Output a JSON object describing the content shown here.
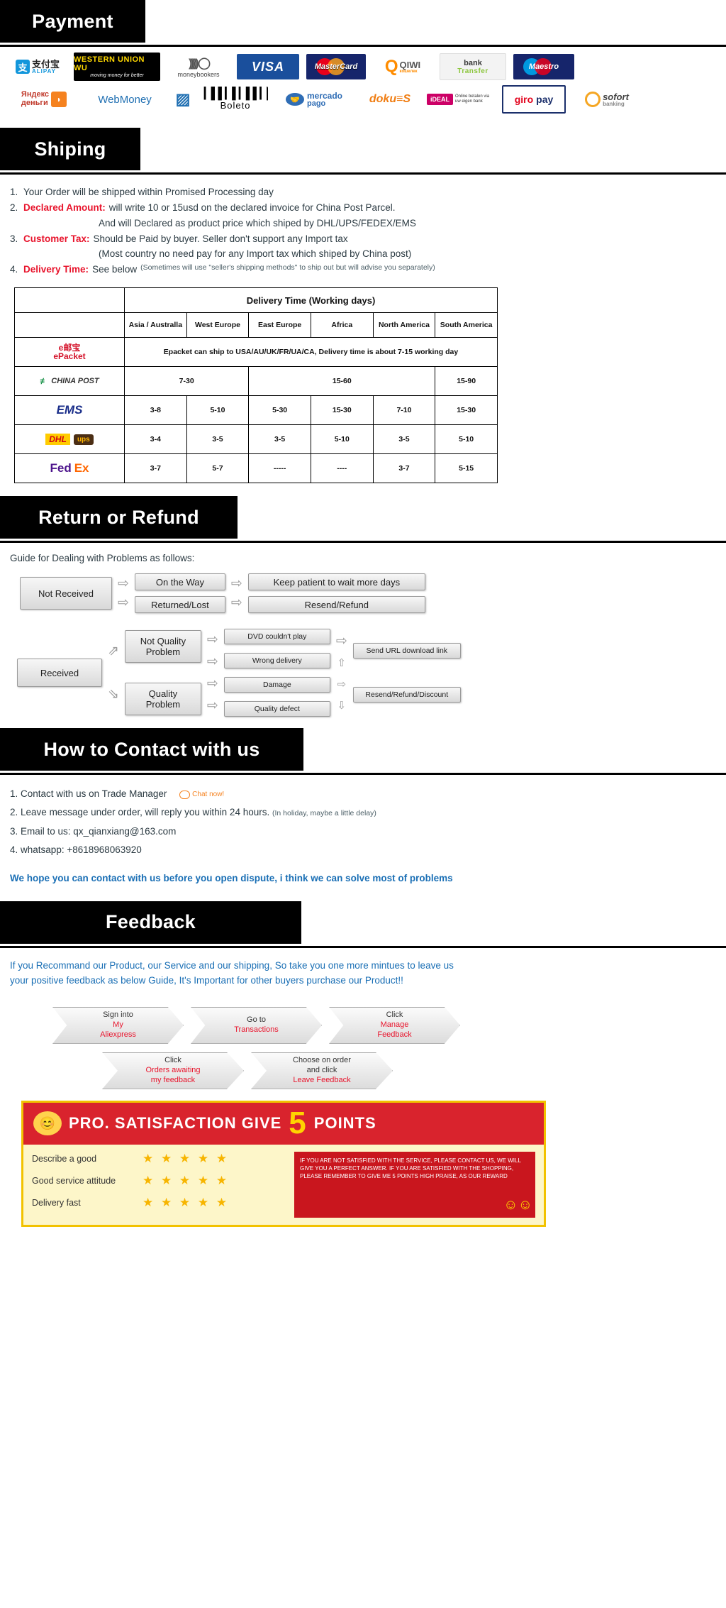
{
  "sections": {
    "payment": "Payment",
    "shipping": "Shiping",
    "return": "Return or Refund",
    "contact": "How to Contact with us",
    "feedback": "Feedback"
  },
  "payment": {
    "row1": [
      {
        "name": "alipay",
        "zh": "支",
        "cn": "支付宝",
        "en": "ALIPAY"
      },
      {
        "name": "western-union",
        "t1": "WESTERN UNION WU",
        "t2": "moving money for better"
      },
      {
        "name": "moneybookers",
        "arcs": "))))) ◯",
        "t": "moneybookers"
      },
      {
        "name": "visa",
        "t": "VISA"
      },
      {
        "name": "mastercard",
        "t": "MasterCard"
      },
      {
        "name": "qiwi",
        "q": "Q",
        "t": "QIWI",
        "sub": "кошелек"
      },
      {
        "name": "bank-transfer",
        "t1": "bank",
        "t2": "Transfer"
      },
      {
        "name": "maestro",
        "t": "Maestro"
      }
    ],
    "row2": [
      {
        "name": "yandex-money",
        "t1": "Яндекс",
        "t2": "деньги",
        "icon": "◗"
      },
      {
        "name": "webmoney",
        "t": "WebMoney"
      },
      {
        "name": "webmoney-icon",
        "t": "▨"
      },
      {
        "name": "boleto",
        "bars": "▌▎▌▌▎▌▎▌▌▎▌",
        "t": "Boleto"
      },
      {
        "name": "mercado-pago",
        "icon": "🤝",
        "t1": "mercado",
        "t2": "pago"
      },
      {
        "name": "doku",
        "t": "doku≡S"
      },
      {
        "name": "ideal",
        "box": "iDEAL",
        "t": "Online betalen via uw eigen bank"
      },
      {
        "name": "giropay",
        "g": "giro",
        "p": "pay"
      },
      {
        "name": "sofort",
        "t": "sofort",
        "sub": "banking"
      }
    ]
  },
  "shipping": {
    "items": [
      {
        "num": "1.",
        "label": "",
        "text": "Your Order will be shipped within Promised Processing day"
      },
      {
        "num": "2.",
        "label": "Declared Amount:",
        "text": "will write 10 or 15usd on the declared invoice for China Post Parcel."
      },
      {
        "num": "",
        "label": "",
        "indent": true,
        "text": "And will Declared as product price which shiped by DHL/UPS/FEDEX/EMS"
      },
      {
        "num": "3.",
        "label": "Customer Tax:",
        "text": "Should be Paid by buyer. Seller don't support any Import tax"
      },
      {
        "num": "",
        "label": "",
        "indent": true,
        "text": "(Most country no need pay for any Import tax which shiped by China post)"
      },
      {
        "num": "4.",
        "label": "Delivery Time:",
        "text": "See below",
        "note": "(Sometimes will use \"seller's shipping methods\" to ship out but will advise you separately)"
      }
    ]
  },
  "delivery_table": {
    "title": "Delivery Time (Working days)",
    "regions": [
      "Asia / Australla",
      "West Europe",
      "East Europe",
      "Africa",
      "North America",
      "South America"
    ],
    "rows": [
      {
        "carrier": "ePacket",
        "type": "epacket",
        "span_note": "Epacket can ship to USA/AU/UK/FR/UA/CA, Delivery time is about 7-15 working day"
      },
      {
        "carrier": "CHINA POST",
        "type": "chinapost",
        "groups": [
          {
            "text": "7-30",
            "span": 2
          },
          {
            "text": "15-60",
            "span": 3
          },
          {
            "text": "15-90",
            "span": 1
          }
        ]
      },
      {
        "carrier": "EMS",
        "type": "ems",
        "values": [
          "3-8",
          "5-10",
          "5-30",
          "15-30",
          "7-10",
          "15-30"
        ]
      },
      {
        "carrier": "DHL / ups",
        "type": "dhl",
        "values": [
          "3-4",
          "3-5",
          "3-5",
          "5-10",
          "3-5",
          "5-10"
        ]
      },
      {
        "carrier": "FedEx",
        "type": "fedex",
        "values": [
          "3-7",
          "5-7",
          "-----",
          "----",
          "3-7",
          "5-15"
        ]
      }
    ]
  },
  "return_flow": {
    "title": "Guide for Dealing with Problems as follows:",
    "not_received": "Not Received",
    "branch1": [
      "On the Way",
      "Returned/Lost"
    ],
    "result1": [
      "Keep patient to wait more days",
      "Resend/Refund"
    ],
    "received": "Received",
    "not_quality": "Not Quality\nProblem",
    "quality": "Quality\nProblem",
    "issues_nq": [
      "DVD couldn't play",
      "Wrong delivery"
    ],
    "issues_q": [
      "Damage",
      "Quality defect"
    ],
    "result_nq": "Send URL download link",
    "result_q": "Resend/Refund/Discount"
  },
  "contact": {
    "items": [
      {
        "num": "1.",
        "text": "Contact with us on Trade Manager",
        "chat": "Chat now!"
      },
      {
        "num": "2.",
        "text": "Leave message under order, will reply you within 24 hours.",
        "note": "(In holiday, maybe a little delay)"
      },
      {
        "num": "3.",
        "text": "Email to us: qx_qianxiang@163.com"
      },
      {
        "num": "4.",
        "text": "whatsapp: +8618968063920"
      }
    ],
    "hope": "We hope you can contact with us before you open dispute, i think we can solve most of problems"
  },
  "feedback": {
    "intro_line1": "If you Recommand our Product, our Service and our shipping, So take you one more mintues to leave us",
    "intro_line2": "your positive feedback as below Guide, It's Important for other buyers purchase our Product!!",
    "steps_row1": [
      {
        "top": "Sign into",
        "red": "My\nAliexpress"
      },
      {
        "top": "Go to",
        "red": "Transactions"
      },
      {
        "top": "Click",
        "red": "Manage\nFeedback"
      }
    ],
    "steps_row2": [
      {
        "top": "Click",
        "red": "Orders awaiting\nmy feedback"
      },
      {
        "top": "Choose on order\nand click",
        "red": "Leave Feedback"
      }
    ],
    "promo": {
      "headline": "PRO. SATISFACTION  GIVE",
      "five": "5",
      "points": "POINTS",
      "rates": [
        "Describe a good",
        "Good service attitude",
        "Delivery fast"
      ],
      "stars": "★ ★ ★ ★ ★",
      "note": "IF YOU ARE NOT SATISFIED WITH THE SERVICE, PLEASE CONTACT US, WE WILL GIVE YOU A PERFECT ANSWER. IF YOU ARE SATISFIED WITH THE SHOPPING, PLEASE REMEMBER TO GIVE ME 5 POINTS HIGH PRAISE, AS OUR REWARD"
    }
  },
  "colors": {
    "accent_red": "#e8142c",
    "blue": "#1a6fb5",
    "black": "#000000"
  }
}
